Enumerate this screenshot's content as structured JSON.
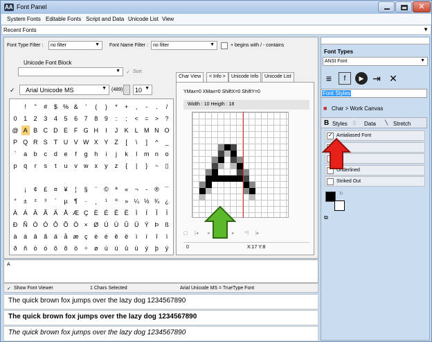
{
  "window": {
    "title": "Font Panel",
    "logo": "AA",
    "close": "✕"
  },
  "menu": {
    "items": [
      "System Fonts",
      "Editable Fonts",
      "Script and Data",
      "Unicode List",
      "View"
    ]
  },
  "recent": {
    "label": "Recent Fonts",
    "arrow": "▼"
  },
  "filters": {
    "type_label": "Font Type Filter :",
    "type_value": "no filter",
    "name_label": "Font Name Filter :",
    "name_value": "no filter",
    "begins_label": "+ begins with / - contains"
  },
  "unicode_block": {
    "label": "Unicode Font Block",
    "sort_label": "Sort",
    "check": "✓"
  },
  "font": {
    "name": "Arial Unicode MS",
    "count": "(489)",
    "size": "10"
  },
  "tabs": [
    "Char View",
    "< Info >",
    "Unicode Info",
    "Unicode List"
  ],
  "charview": {
    "metrics": "YMax=0  XMax=0  ShiftX=0  ShiftY=0",
    "size": "Width : 10  Heigth : 18",
    "index": "0",
    "pos": "X:17 Y:8"
  },
  "grid_rows": [
    [
      " ",
      "!",
      "\"",
      "#",
      "$",
      "%",
      "&",
      "'",
      "(",
      ")",
      "*",
      "+",
      ",",
      "-",
      ".",
      "/"
    ],
    [
      "0",
      "1",
      "2",
      "3",
      "4",
      "5",
      "6",
      "7",
      "8",
      "9",
      ":",
      ";",
      "<",
      "=",
      ">",
      "?"
    ],
    [
      "@",
      "A",
      "B",
      "C",
      "D",
      "E",
      "F",
      "G",
      "H",
      "I",
      "J",
      "K",
      "L",
      "M",
      "N",
      "O"
    ],
    [
      "P",
      "Q",
      "R",
      "S",
      "T",
      "U",
      "V",
      "W",
      "X",
      "Y",
      "Z",
      "[",
      "\\",
      "]",
      "^",
      "_"
    ],
    [
      "`",
      "a",
      "b",
      "c",
      "d",
      "e",
      "f",
      "g",
      "h",
      "i",
      "j",
      "k",
      "l",
      "m",
      "n",
      "o"
    ],
    [
      "p",
      "q",
      "r",
      "s",
      "t",
      "u",
      "v",
      "w",
      "x",
      "y",
      "z",
      "{",
      "|",
      "}",
      "~",
      "▯"
    ],
    [
      " ",
      " ",
      " ",
      " ",
      " ",
      " ",
      " ",
      " ",
      " ",
      " ",
      " ",
      " ",
      " ",
      " ",
      " ",
      " "
    ],
    [
      " ",
      "¡",
      "¢",
      "£",
      "¤",
      "¥",
      "¦",
      "§",
      "¨",
      "©",
      "ª",
      "«",
      "¬",
      "-",
      "®",
      "¯"
    ],
    [
      "°",
      "±",
      "²",
      "³",
      "´",
      "µ",
      "¶",
      "·",
      "¸",
      "¹",
      "º",
      "»",
      "¼",
      "½",
      "¾",
      "¿"
    ],
    [
      "À",
      "Á",
      "Â",
      "Ã",
      "Ä",
      "Å",
      "Æ",
      "Ç",
      "È",
      "É",
      "Ê",
      "Ë",
      "Ì",
      "Í",
      "Î",
      "Ï"
    ],
    [
      "Đ",
      "Ñ",
      "Ò",
      "Ó",
      "Ô",
      "Õ",
      "Ö",
      "×",
      "Ø",
      "Ù",
      "Ú",
      "Û",
      "Ü",
      "Ý",
      "Þ",
      "ß"
    ],
    [
      "à",
      "á",
      "â",
      "ã",
      "ä",
      "å",
      "æ",
      "ç",
      "è",
      "é",
      "ê",
      "ë",
      "ì",
      "í",
      "î",
      "ï"
    ],
    [
      "ð",
      "ñ",
      "ò",
      "ó",
      "ô",
      "õ",
      "ö",
      "÷",
      "ø",
      "ù",
      "ú",
      "û",
      "ü",
      "ý",
      "þ",
      "ÿ"
    ]
  ],
  "preview_text": "A",
  "status": {
    "show_viewer": "Show Font Viewer",
    "selected": "1 Chars Selected",
    "type": "Arial Unicode MS = TrueType Font"
  },
  "samples": [
    "The quick brown fox jumps over the lazy dog 1234567890",
    "The quick brown fox jumps over the lazy dog 1234567890",
    "The quick brown fox jumps over the lazy dog 1234567890"
  ],
  "right": {
    "font_types_label": "Font Types",
    "font_type_value": "ANSI Font",
    "font_styles": "Font Styles",
    "char_to_canvas": "Char > Work Canvas",
    "tabs": [
      "Styles",
      "Data",
      "Stretch"
    ],
    "options": [
      "Antialiased Font",
      "",
      "",
      "Underlined",
      "Striked Out"
    ]
  },
  "colors": {
    "accent": "#3399ff",
    "arrow_red": "#e8201a",
    "arrow_green": "#5bb82a",
    "title_bg": "#a9c4e6"
  }
}
